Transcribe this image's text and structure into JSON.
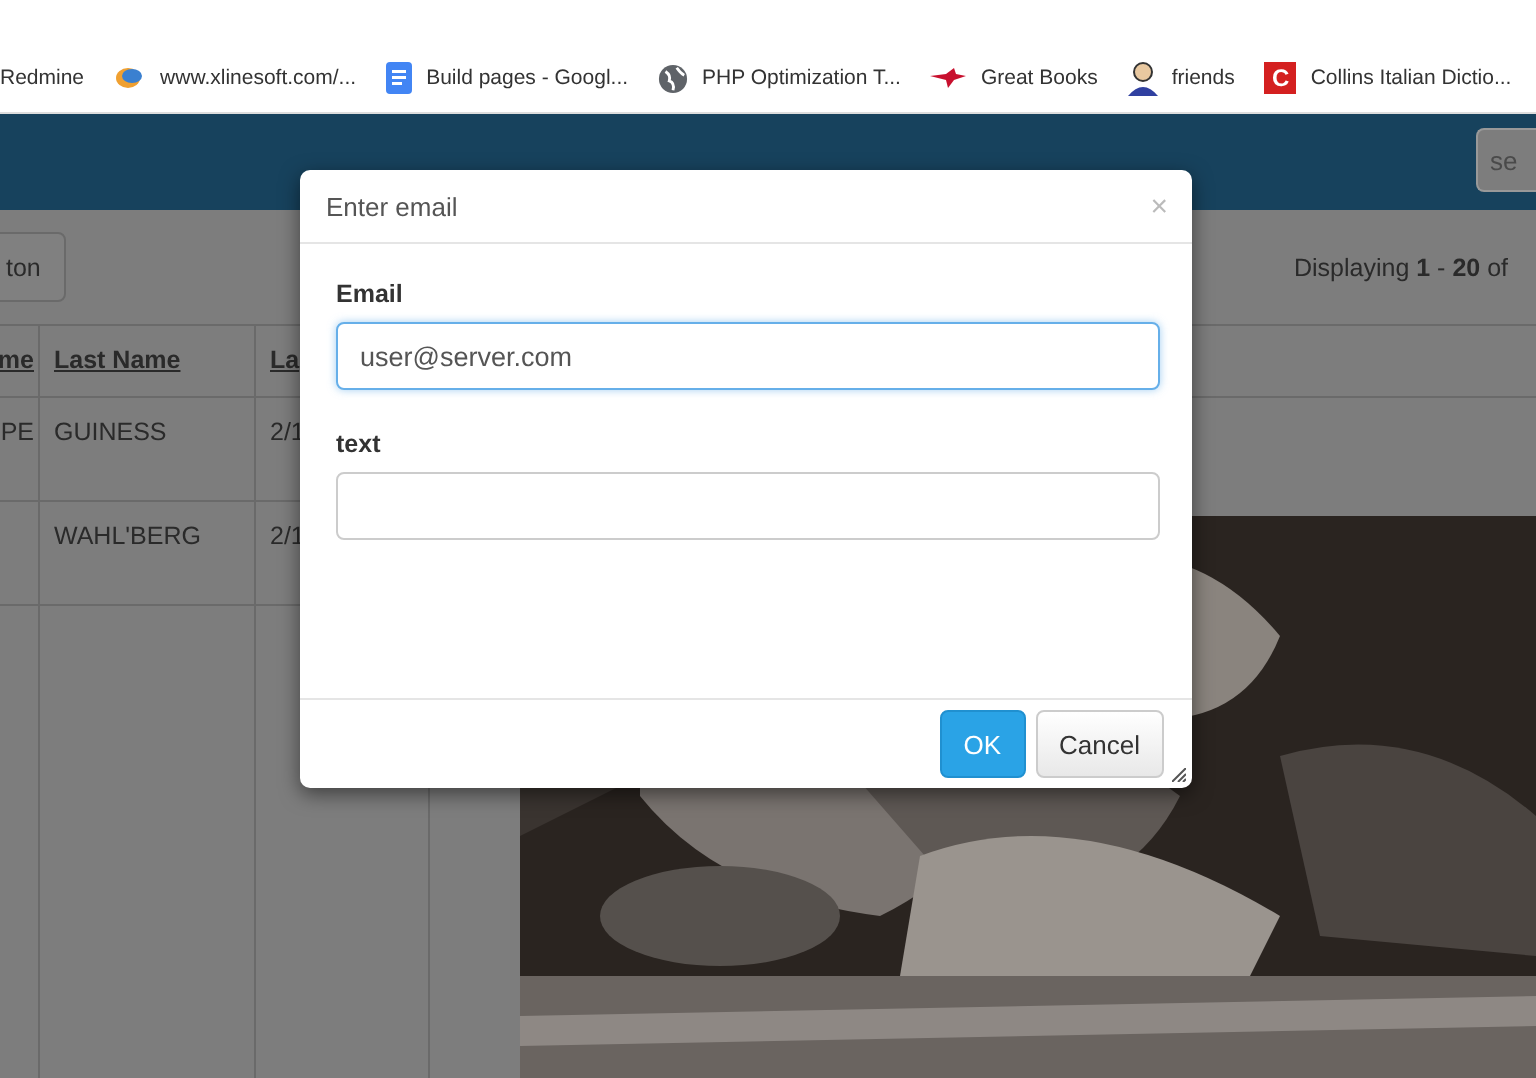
{
  "bookmarks": [
    {
      "label": "Redmine"
    },
    {
      "label": "www.xlinesoft.com/..."
    },
    {
      "label": "Build pages - Googl..."
    },
    {
      "label": "PHP Optimization T..."
    },
    {
      "label": "Great Books"
    },
    {
      "label": "friends"
    },
    {
      "label": "Collins Italian Dictio...",
      "letter": "C"
    }
  ],
  "header": {
    "search": {
      "placeholder": "se"
    }
  },
  "toolbar": {
    "button": "ton",
    "pager": "Displaying **1** - **20** of"
  },
  "table": {
    "columns": [
      "me",
      "Last Name",
      "La"
    ],
    "rows": [
      {
        "column_1": "PE",
        "last_name": "GUINESS",
        "column_3": "2/1"
      },
      {
        "last_name": "WAHL'BERG",
        "column_3": "2/1"
      }
    ]
  },
  "dialog": {
    "title": "Enter email",
    "close": "×",
    "fields": [
      {
        "label": "Email",
        "value": "user@server.com",
        "focused": true
      },
      {
        "label": "text",
        "focused": false
      }
    ],
    "buttons": [
      {
        "label": "OK",
        "kind": "primary"
      },
      {
        "label": "Cancel",
        "kind": "default"
      }
    ]
  }
}
